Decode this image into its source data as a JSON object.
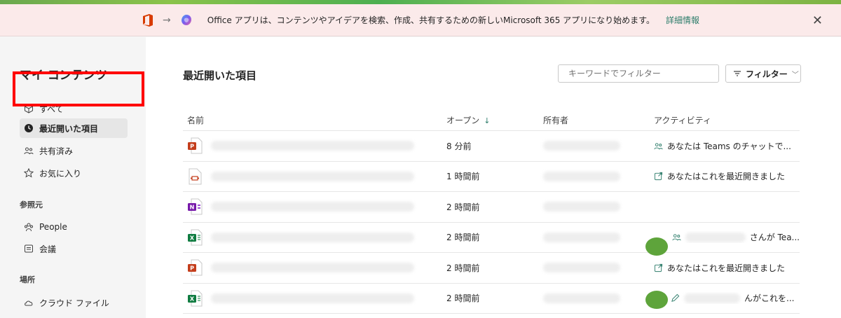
{
  "banner": {
    "text": "Office アプリは、コンテンツやアイデアを検索、作成、共有するための新しいMicrosoft 365 アプリになり始めます。",
    "link": "詳細情報",
    "close": "✕",
    "arrow": "→"
  },
  "sidebar": {
    "title": "マイ コンテンツ",
    "items": [
      {
        "label": "すべて",
        "icon": "cube-icon"
      },
      {
        "label": "最近開いた項目",
        "icon": "clock-icon"
      },
      {
        "label": "共有済み",
        "icon": "people-icon"
      },
      {
        "label": "お気に入り",
        "icon": "star-icon"
      }
    ],
    "section_ref": "参照元",
    "ref_items": [
      {
        "label": "People",
        "icon": "people-group-icon"
      },
      {
        "label": "会議",
        "icon": "meeting-icon"
      }
    ],
    "section_place": "場所",
    "place_items": [
      {
        "label": "クラウド ファイル",
        "icon": "cloud-icon"
      }
    ]
  },
  "main": {
    "title": "最近開いた項目",
    "filter_placeholder": "キーワードでフィルター",
    "filter_button": "フィルター",
    "filter_chevron": "﹀",
    "columns": {
      "name": "名前",
      "open": "オープン",
      "owner": "所有者",
      "activity": "アクティビティ"
    },
    "sort_arrow": "↓",
    "rows": [
      {
        "type": "powerpoint",
        "open": "8 分前",
        "activity": "あなたは Teams のチャットで...",
        "activity_icon": "people-icon"
      },
      {
        "type": "video",
        "open": "1 時間前",
        "activity": "あなたはこれを最近開きました",
        "activity_icon": "open-external-icon"
      },
      {
        "type": "onenote",
        "open": "2 時間前",
        "activity": "",
        "activity_icon": ""
      },
      {
        "type": "excel",
        "open": "2 時間前",
        "activity": "さんが Tea...",
        "activity_icon": "people-icon"
      },
      {
        "type": "powerpoint",
        "open": "2 時間前",
        "activity": "あなたはこれを最近開きました",
        "activity_icon": "open-external-icon"
      },
      {
        "type": "excel",
        "open": "2 時間前",
        "activity": "んがこれを...",
        "activity_icon": "pencil-icon"
      }
    ]
  },
  "colors": {
    "accent": "#2e7d6b",
    "highlight": "#ff0000",
    "banner_bg": "#fbeaea"
  }
}
